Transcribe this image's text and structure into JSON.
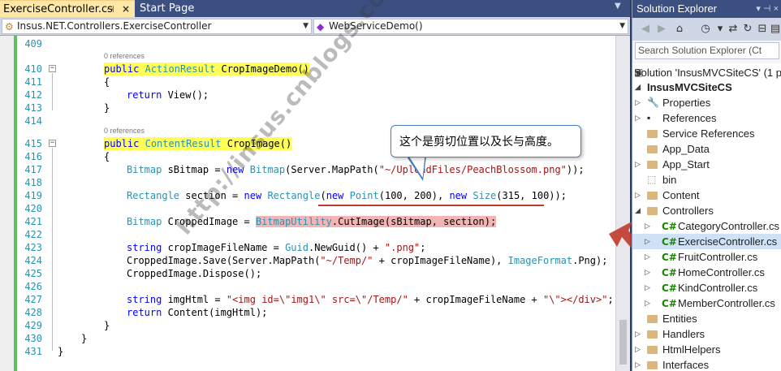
{
  "editor_tabs": {
    "active": "ExerciseController.cs",
    "inactive": "Start Page"
  },
  "navbar": {
    "class_combo": "Insus.NET.Controllers.ExerciseController",
    "member_combo": "WebServiceDemo()"
  },
  "code": {
    "references_label": "0 references",
    "lines": [
      {
        "n": "409",
        "t": ""
      },
      {
        "n": "410",
        "t": "public ActionResult CropImageDemo()"
      },
      {
        "n": "411",
        "t": "{"
      },
      {
        "n": "412",
        "t": "return View();"
      },
      {
        "n": "413",
        "t": "}"
      },
      {
        "n": "414",
        "t": ""
      },
      {
        "n": "415",
        "t": "public ContentResult CropImage()"
      },
      {
        "n": "416",
        "t": "{"
      },
      {
        "n": "417",
        "t": "Bitmap sBitmap = new Bitmap(Server.MapPath(\"~/UploadFiles/PeachBlossom.png\"));"
      },
      {
        "n": "418",
        "t": ""
      },
      {
        "n": "419",
        "t": "Rectangle section = new Rectangle(new Point(100, 200), new Size(315, 100));"
      },
      {
        "n": "420",
        "t": ""
      },
      {
        "n": "421",
        "t": "Bitmap CroppedImage = BitmapUtility.CutImage(sBitmap, section);"
      },
      {
        "n": "422",
        "t": ""
      },
      {
        "n": "423",
        "t": "string cropImageFileName = Guid.NewGuid() + \".png\";"
      },
      {
        "n": "424",
        "t": "CroppedImage.Save(Server.MapPath(\"~/Temp/\" + cropImageFileName), ImageFormat.Png);"
      },
      {
        "n": "425",
        "t": "CroppedImage.Dispose();"
      },
      {
        "n": "426",
        "t": ""
      },
      {
        "n": "427",
        "t": "string imgHtml = \"<img id=\\\"img1\\\" src=\\\"/Temp/\" + cropImageFileName + \"\\\"></div>\";"
      },
      {
        "n": "428",
        "t": "return Content(imgHtml);"
      },
      {
        "n": "429",
        "t": "}"
      },
      {
        "n": "430",
        "t": "}"
      },
      {
        "n": "431",
        "t": "}"
      }
    ]
  },
  "callout": {
    "text": "这个是剪切位置以及长与高度。"
  },
  "watermark": "http://insus.cnblogs.com",
  "solution_explorer": {
    "title": "Solution Explorer",
    "search_placeholder": "Search Solution Explorer (Ct",
    "solution_label": "Solution 'InsusMVCSiteCS' (1 p",
    "project_label": "InsusMVCSiteCS",
    "items": [
      {
        "label": "Properties",
        "icon": "wrench-icon"
      },
      {
        "label": "References",
        "icon": "references-icon"
      },
      {
        "label": "Service References",
        "icon": "folder-icon"
      },
      {
        "label": "App_Data",
        "icon": "folder-icon"
      },
      {
        "label": "App_Start",
        "icon": "folder-icon"
      },
      {
        "label": "bin",
        "icon": "dotted-folder-icon"
      },
      {
        "label": "Content",
        "icon": "folder-icon"
      },
      {
        "label": "Controllers",
        "icon": "folder-icon"
      },
      {
        "label": "CategoryController.cs",
        "icon": "csharp-file-icon"
      },
      {
        "label": "ExerciseController.cs",
        "icon": "csharp-file-icon"
      },
      {
        "label": "FruitController.cs",
        "icon": "csharp-file-icon"
      },
      {
        "label": "HomeController.cs",
        "icon": "csharp-file-icon"
      },
      {
        "label": "KindController.cs",
        "icon": "csharp-file-icon"
      },
      {
        "label": "MemberController.cs",
        "icon": "csharp-file-icon"
      },
      {
        "label": "Entities",
        "icon": "folder-icon"
      },
      {
        "label": "Handlers",
        "icon": "folder-icon"
      },
      {
        "label": "HtmlHelpers",
        "icon": "folder-icon"
      },
      {
        "label": "Interfaces",
        "icon": "folder-icon"
      }
    ],
    "csharp_badge": "C#"
  },
  "colors": {
    "keyword": "#0000ff",
    "type": "#2b91af",
    "string": "#a31515",
    "highlight_yellow": "#ffff55",
    "highlight_pink": "#f4b4b4",
    "arrow": "#c0392b",
    "title_bar": "#3b4f81"
  }
}
